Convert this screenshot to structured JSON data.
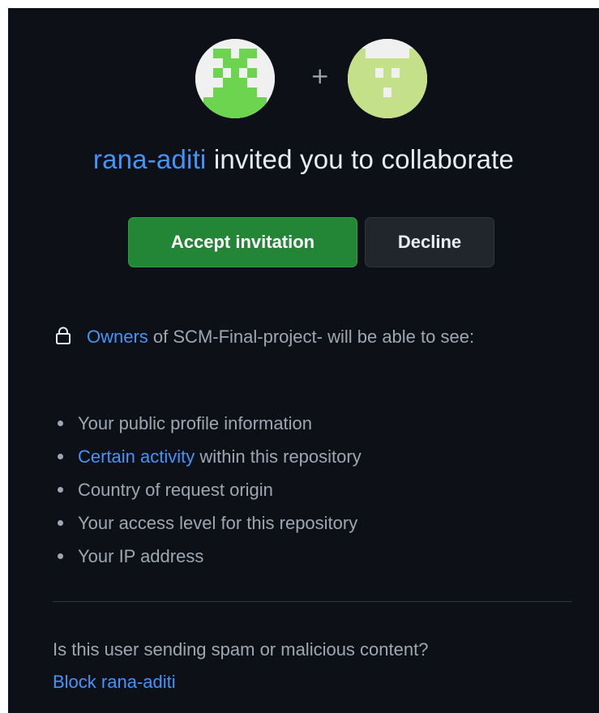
{
  "avatars": {
    "plus_sign": "+",
    "left_avatar_colors": {
      "primary": "#6cd44f",
      "background": "#f0f0f0"
    },
    "right_avatar_colors": {
      "primary": "#c4e089",
      "background": "#f0f0f0"
    }
  },
  "invitation": {
    "inviter": "rana-aditi",
    "message": "invited you to collaborate"
  },
  "actions": {
    "accept_label": "Accept invitation",
    "decline_label": "Decline"
  },
  "visibility": {
    "icon": "lock-icon",
    "owners_link": "Owners",
    "statement": "of SCM-Final-project- will be able to see:",
    "items": [
      {
        "text": "Your public profile information"
      },
      {
        "link": "Certain activity",
        "text": "within this repository"
      },
      {
        "text": "Country of request origin"
      },
      {
        "text": "Your access level for this repository"
      },
      {
        "text": "Your IP address"
      }
    ]
  },
  "spam": {
    "question": "Is this user sending spam or malicious content?",
    "block_link": "Block rana-aditi"
  },
  "colors": {
    "background": "#0d1117",
    "text": "#e6edf3",
    "muted_text": "#9da7b3",
    "link": "#4493f8",
    "accept_button": "#238636",
    "decline_button": "#21262d"
  }
}
